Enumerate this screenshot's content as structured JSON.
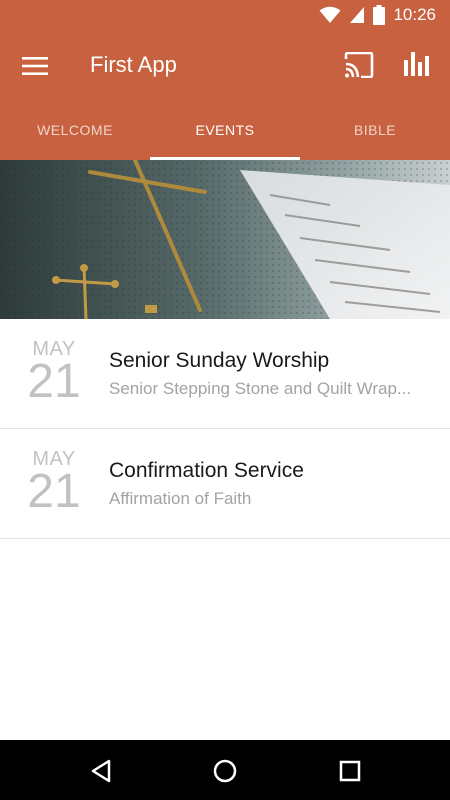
{
  "status_bar": {
    "time": "10:26",
    "icons": [
      "wifi-icon",
      "cell-signal-icon",
      "battery-icon"
    ]
  },
  "toolbar": {
    "title": "First App",
    "icons": [
      "menu-icon",
      "cast-icon",
      "bar-chart-icon"
    ],
    "color": "#c8613f"
  },
  "tabs": [
    {
      "label": "WELCOME",
      "active": false
    },
    {
      "label": "EVENTS",
      "active": true
    },
    {
      "label": "BIBLE",
      "active": false
    }
  ],
  "events": [
    {
      "month": "MAY",
      "day": "21",
      "title": "Senior Sunday Worship",
      "subtitle": "Senior Stepping Stone and Quilt Wrap..."
    },
    {
      "month": "MAY",
      "day": "21",
      "title": "Confirmation Service",
      "subtitle": "Affirmation of Faith"
    }
  ],
  "nav_bar": {
    "icons": [
      "back-icon",
      "home-icon",
      "recents-icon"
    ]
  }
}
